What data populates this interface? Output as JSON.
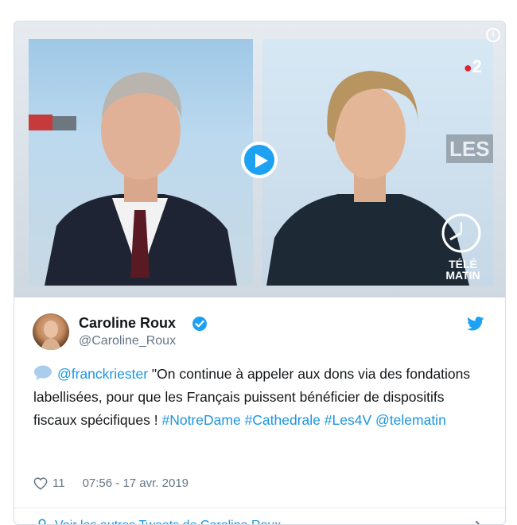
{
  "media": {
    "channel_logo": "2",
    "overlay_text": "LES",
    "show_name_line1": "TÉLÉ",
    "show_name_line2": "MATIN",
    "info_glyph": "i",
    "play_icon": "play-icon"
  },
  "author": {
    "name": "Caroline Roux",
    "handle": "@Caroline_Roux",
    "verified": true
  },
  "tweet": {
    "mention": "@franckriester",
    "text": " \"On continue à appeler aux dons via des fondations labellisées, pour que les Français puissent bénéficier de dispositifs fiscaux spécifiques ! ",
    "hashtag1": "#NotreDame",
    "hashtag2": "#Cathedrale",
    "hashtag3": "#Les4V",
    "mention2": "@telematin",
    "likes": "11",
    "timestamp": "07:56 - 17 avr. 2019"
  },
  "footer": {
    "label": "Voir les autres Tweets de Caroline Roux"
  },
  "colors": {
    "accent": "#1da1f2",
    "link": "#1b95e0",
    "muted": "#657786"
  }
}
